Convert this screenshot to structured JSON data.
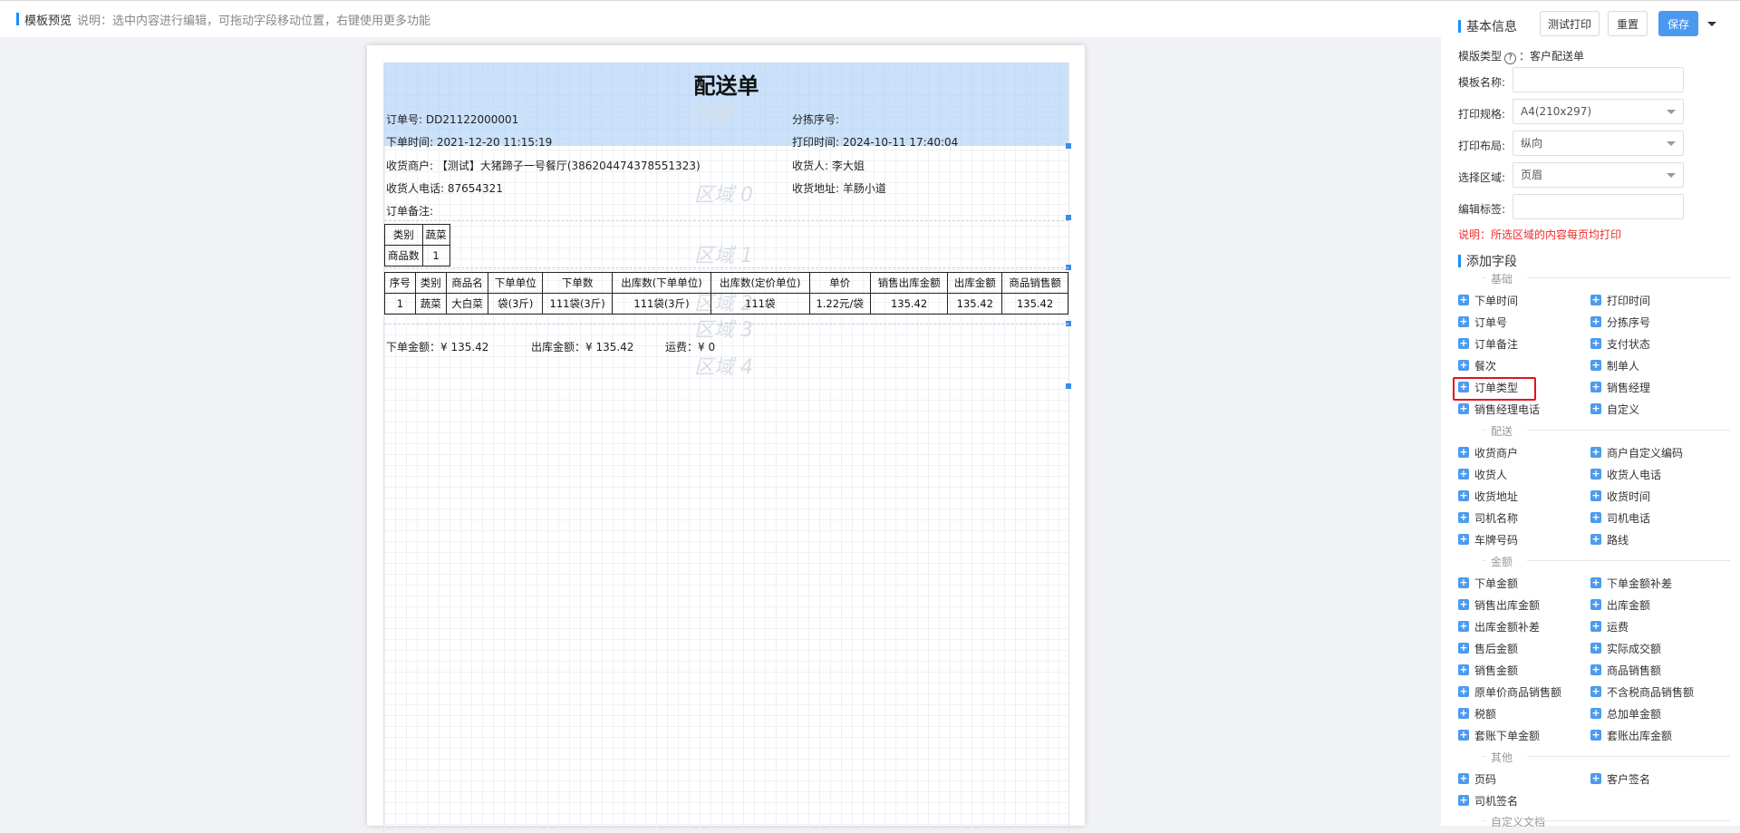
{
  "header": {
    "title": "模板预览",
    "hint": "说明：选中内容进行编辑，可拖动字段移动位置，右键使用更多功能"
  },
  "doc": {
    "title": "配送单",
    "watermarks": [
      "页眉",
      "区域 0",
      "区域 1",
      "区域 2",
      "区域 3",
      "区域 4"
    ],
    "order_no": "订单号: DD21122000001",
    "sort_no": "分拣序号:",
    "order_time": "下单时间:  2021-12-20 11:15:19",
    "print_time": "打印时间:  2024-10-11 17:40:04",
    "merchant": "收货商户: 【测试】大猪蹄子一号餐厅(386204474378551323)",
    "receiver": "收货人: 李大姐",
    "receiver_phone": "收货人电话: 87654321",
    "receiver_addr": "收货地址: 羊肠小道",
    "remark": "订单备注:",
    "category_table": [
      [
        "类别",
        "蔬菜"
      ],
      [
        "商品数",
        "1"
      ]
    ],
    "items_header": [
      "序号",
      "类别",
      "商品名",
      "下单单位",
      "下单数",
      "出库数(下单单位)",
      "出库数(定价单位)",
      "单价",
      "销售出库金额",
      "出库金额",
      "商品销售额"
    ],
    "items_rows": [
      [
        "1",
        "蔬菜",
        "大白菜",
        "袋(3斤)",
        "111袋(3斤)",
        "111袋(3斤)",
        "111袋",
        "1.22元/袋",
        "135.42",
        "135.42",
        "135.42"
      ]
    ],
    "order_amount": "下单金额：¥ 135.42",
    "out_amount": "出库金额：¥ 135.42",
    "freight": "运费：¥ 0"
  },
  "panel": {
    "basic_title": "基本信息",
    "btn_test_print": "测试打印",
    "btn_reset": "重置",
    "btn_save": "保存",
    "template_type_label": "模版类型",
    "template_type_value": "：客户配送单",
    "name_label": "模板名称:",
    "name_value": "",
    "spec_label": "打印规格:",
    "spec_value": "A4(210x297)",
    "layout_label": "打印布局:",
    "layout_value": "纵向",
    "region_label": "选择区域:",
    "region_value": "页眉",
    "tag_label": "编辑标签:",
    "tag_value": "",
    "note": "说明：所选区域的内容每页均打印",
    "add_field_title": "添加字段",
    "groups": [
      {
        "name": "基础",
        "items": [
          "下单时间",
          "打印时间",
          "订单号",
          "分拣序号",
          "订单备注",
          "支付状态",
          "餐次",
          "制单人",
          "订单类型",
          "销售经理",
          "销售经理电话",
          "自定义"
        ]
      },
      {
        "name": "配送",
        "items": [
          "收货商户",
          "商户自定义编码",
          "收货人",
          "收货人电话",
          "收货地址",
          "收货时间",
          "司机名称",
          "司机电话",
          "车牌号码",
          "路线"
        ]
      },
      {
        "name": "金额",
        "items": [
          "下单金额",
          "下单金额补差",
          "销售出库金额",
          "出库金额",
          "出库金额补差",
          "运费",
          "售后金额",
          "实际成交额",
          "销售金额",
          "商品销售额",
          "原单价商品销售额",
          "不含税商品销售额",
          "税额",
          "总加单金额",
          "套账下单金额",
          "套账出库金额"
        ]
      },
      {
        "name": "其他",
        "items": [
          "页码",
          "客户签名",
          "司机签名"
        ]
      },
      {
        "name": "自定义文档",
        "items": []
      }
    ]
  }
}
